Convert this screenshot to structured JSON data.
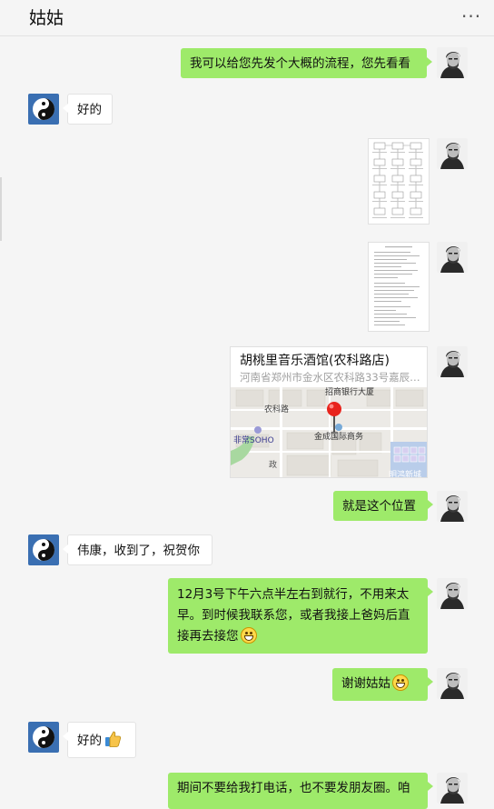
{
  "header": {
    "title": "姑姑",
    "more_icon": "more-icon"
  },
  "messages": {
    "m1": {
      "text": "我可以给您先发个大概的流程，您先看看"
    },
    "m2": {
      "text": "好的"
    },
    "m5": {
      "name": "胡桃里音乐酒馆(农科路店)",
      "address": "河南省郑州市金水区农科路33号嘉辰…",
      "map_labels": {
        "bank": "招商银行大厦",
        "road": "农科路",
        "soho": "非常SOHO",
        "center": "金成国际商务",
        "zheng": "政",
        "minghong": "明鸿新城"
      }
    },
    "m6": {
      "text": "就是这个位置"
    },
    "m7": {
      "text": "伟康，收到了，祝贺你"
    },
    "m8": {
      "text": "12月3号下午六点半左右到就行，不用来太早。到时候我联系您，或者我接上爸妈后直接再去接您"
    },
    "m9": {
      "text": "谢谢姑姑"
    },
    "m10": {
      "text": "好的"
    },
    "m11": {
      "text": "期间不要给我打电话，也不要发朋友圈。咱"
    }
  },
  "colors": {
    "my_bubble": "#9eea6a",
    "other_bubble": "#ffffff",
    "background": "#f5f5f5"
  }
}
